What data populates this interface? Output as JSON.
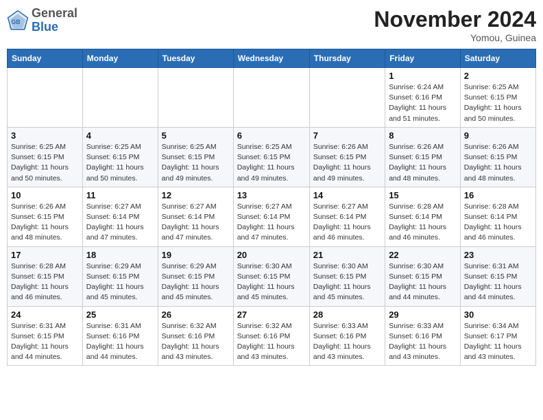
{
  "header": {
    "logo_general": "General",
    "logo_blue": "Blue",
    "month_title": "November 2024",
    "location": "Yomou, Guinea"
  },
  "weekdays": [
    "Sunday",
    "Monday",
    "Tuesday",
    "Wednesday",
    "Thursday",
    "Friday",
    "Saturday"
  ],
  "weeks": [
    [
      null,
      null,
      null,
      null,
      null,
      {
        "day": "1",
        "sunrise": "Sunrise: 6:24 AM",
        "sunset": "Sunset: 6:16 PM",
        "daylight": "Daylight: 11 hours and 51 minutes."
      },
      {
        "day": "2",
        "sunrise": "Sunrise: 6:25 AM",
        "sunset": "Sunset: 6:15 PM",
        "daylight": "Daylight: 11 hours and 50 minutes."
      }
    ],
    [
      {
        "day": "3",
        "sunrise": "Sunrise: 6:25 AM",
        "sunset": "Sunset: 6:15 PM",
        "daylight": "Daylight: 11 hours and 50 minutes."
      },
      {
        "day": "4",
        "sunrise": "Sunrise: 6:25 AM",
        "sunset": "Sunset: 6:15 PM",
        "daylight": "Daylight: 11 hours and 50 minutes."
      },
      {
        "day": "5",
        "sunrise": "Sunrise: 6:25 AM",
        "sunset": "Sunset: 6:15 PM",
        "daylight": "Daylight: 11 hours and 49 minutes."
      },
      {
        "day": "6",
        "sunrise": "Sunrise: 6:25 AM",
        "sunset": "Sunset: 6:15 PM",
        "daylight": "Daylight: 11 hours and 49 minutes."
      },
      {
        "day": "7",
        "sunrise": "Sunrise: 6:26 AM",
        "sunset": "Sunset: 6:15 PM",
        "daylight": "Daylight: 11 hours and 49 minutes."
      },
      {
        "day": "8",
        "sunrise": "Sunrise: 6:26 AM",
        "sunset": "Sunset: 6:15 PM",
        "daylight": "Daylight: 11 hours and 48 minutes."
      },
      {
        "day": "9",
        "sunrise": "Sunrise: 6:26 AM",
        "sunset": "Sunset: 6:15 PM",
        "daylight": "Daylight: 11 hours and 48 minutes."
      }
    ],
    [
      {
        "day": "10",
        "sunrise": "Sunrise: 6:26 AM",
        "sunset": "Sunset: 6:15 PM",
        "daylight": "Daylight: 11 hours and 48 minutes."
      },
      {
        "day": "11",
        "sunrise": "Sunrise: 6:27 AM",
        "sunset": "Sunset: 6:14 PM",
        "daylight": "Daylight: 11 hours and 47 minutes."
      },
      {
        "day": "12",
        "sunrise": "Sunrise: 6:27 AM",
        "sunset": "Sunset: 6:14 PM",
        "daylight": "Daylight: 11 hours and 47 minutes."
      },
      {
        "day": "13",
        "sunrise": "Sunrise: 6:27 AM",
        "sunset": "Sunset: 6:14 PM",
        "daylight": "Daylight: 11 hours and 47 minutes."
      },
      {
        "day": "14",
        "sunrise": "Sunrise: 6:27 AM",
        "sunset": "Sunset: 6:14 PM",
        "daylight": "Daylight: 11 hours and 46 minutes."
      },
      {
        "day": "15",
        "sunrise": "Sunrise: 6:28 AM",
        "sunset": "Sunset: 6:14 PM",
        "daylight": "Daylight: 11 hours and 46 minutes."
      },
      {
        "day": "16",
        "sunrise": "Sunrise: 6:28 AM",
        "sunset": "Sunset: 6:14 PM",
        "daylight": "Daylight: 11 hours and 46 minutes."
      }
    ],
    [
      {
        "day": "17",
        "sunrise": "Sunrise: 6:28 AM",
        "sunset": "Sunset: 6:15 PM",
        "daylight": "Daylight: 11 hours and 46 minutes."
      },
      {
        "day": "18",
        "sunrise": "Sunrise: 6:29 AM",
        "sunset": "Sunset: 6:15 PM",
        "daylight": "Daylight: 11 hours and 45 minutes."
      },
      {
        "day": "19",
        "sunrise": "Sunrise: 6:29 AM",
        "sunset": "Sunset: 6:15 PM",
        "daylight": "Daylight: 11 hours and 45 minutes."
      },
      {
        "day": "20",
        "sunrise": "Sunrise: 6:30 AM",
        "sunset": "Sunset: 6:15 PM",
        "daylight": "Daylight: 11 hours and 45 minutes."
      },
      {
        "day": "21",
        "sunrise": "Sunrise: 6:30 AM",
        "sunset": "Sunset: 6:15 PM",
        "daylight": "Daylight: 11 hours and 45 minutes."
      },
      {
        "day": "22",
        "sunrise": "Sunrise: 6:30 AM",
        "sunset": "Sunset: 6:15 PM",
        "daylight": "Daylight: 11 hours and 44 minutes."
      },
      {
        "day": "23",
        "sunrise": "Sunrise: 6:31 AM",
        "sunset": "Sunset: 6:15 PM",
        "daylight": "Daylight: 11 hours and 44 minutes."
      }
    ],
    [
      {
        "day": "24",
        "sunrise": "Sunrise: 6:31 AM",
        "sunset": "Sunset: 6:15 PM",
        "daylight": "Daylight: 11 hours and 44 minutes."
      },
      {
        "day": "25",
        "sunrise": "Sunrise: 6:31 AM",
        "sunset": "Sunset: 6:16 PM",
        "daylight": "Daylight: 11 hours and 44 minutes."
      },
      {
        "day": "26",
        "sunrise": "Sunrise: 6:32 AM",
        "sunset": "Sunset: 6:16 PM",
        "daylight": "Daylight: 11 hours and 43 minutes."
      },
      {
        "day": "27",
        "sunrise": "Sunrise: 6:32 AM",
        "sunset": "Sunset: 6:16 PM",
        "daylight": "Daylight: 11 hours and 43 minutes."
      },
      {
        "day": "28",
        "sunrise": "Sunrise: 6:33 AM",
        "sunset": "Sunset: 6:16 PM",
        "daylight": "Daylight: 11 hours and 43 minutes."
      },
      {
        "day": "29",
        "sunrise": "Sunrise: 6:33 AM",
        "sunset": "Sunset: 6:16 PM",
        "daylight": "Daylight: 11 hours and 43 minutes."
      },
      {
        "day": "30",
        "sunrise": "Sunrise: 6:34 AM",
        "sunset": "Sunset: 6:17 PM",
        "daylight": "Daylight: 11 hours and 43 minutes."
      }
    ]
  ]
}
